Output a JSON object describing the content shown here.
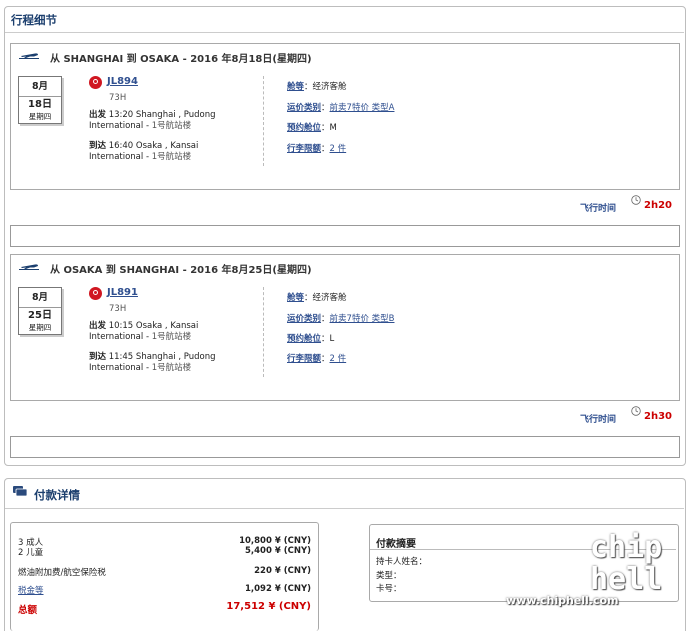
{
  "itinerary": {
    "title": "行程细节",
    "flights": [
      {
        "route": "从 SHANGHAI 到 OSAKA - 2016 年8月18日(星期四)",
        "month": "8月",
        "day": "18日",
        "weekday": "星期四",
        "flight_no": "JL894",
        "aircraft": "73H",
        "dep_label": "出发",
        "dep_time": "13:20",
        "dep_place": "Shanghai , Pudong International -",
        "dep_terminal": "1号航站楼",
        "arr_label": "到达",
        "arr_time": "16:40",
        "arr_place": "Osaka , Kansai International -",
        "arr_terminal": "1号航站楼",
        "cabin_label": "舱等",
        "cabin_value": "经济客舱",
        "fare_label": "运价类别",
        "fare_value": "前卖7特价 类型A",
        "booking_label": "预约舱位",
        "booking_value": "M",
        "baggage_label": "行李限额",
        "baggage_value": "2 件",
        "duration_label": "飞行时间",
        "duration": "2h20"
      },
      {
        "route": "从 OSAKA 到 SHANGHAI - 2016 年8月25日(星期四)",
        "month": "8月",
        "day": "25日",
        "weekday": "星期四",
        "flight_no": "JL891",
        "aircraft": "73H",
        "dep_label": "出发",
        "dep_time": "10:15",
        "dep_place": "Osaka , Kansai International -",
        "dep_terminal": "1号航站楼",
        "arr_label": "到达",
        "arr_time": "11:45",
        "arr_place": "Shanghai , Pudong International -",
        "arr_terminal": "1号航站楼",
        "cabin_label": "舱等",
        "cabin_value": "经济客舱",
        "fare_label": "运价类别",
        "fare_value": "前卖7特价 类型B",
        "booking_label": "预约舱位",
        "booking_value": "L",
        "baggage_label": "行李限额",
        "baggage_value": "2 件",
        "duration_label": "飞行时间",
        "duration": "2h30"
      }
    ]
  },
  "payment": {
    "title": "付款详情",
    "lines": [
      {
        "label": "3 成人",
        "value": "10,800 ¥ (CNY)"
      },
      {
        "label": "2 儿童",
        "value": "5,400 ¥ (CNY)"
      },
      {
        "label": "燃油附加费/航空保险税",
        "value": "220 ¥ (CNY)"
      },
      {
        "label": "税金等",
        "value": "1,092 ¥ (CNY)"
      }
    ],
    "total_label": "总额",
    "total_value": "17,512 ¥ (CNY)",
    "summary": {
      "title": "付款摘要",
      "holder_label": "持卡人姓名：",
      "type_label": "类型：",
      "card_label": "卡号："
    }
  },
  "watermark": {
    "url": "www.chiphell.com",
    "logo": "chip hell"
  },
  "colors": {
    "title_blue": "#1c3f6e",
    "link_blue": "#2f4f8f",
    "red": "#cc0000",
    "jal_red": "#d01721"
  }
}
